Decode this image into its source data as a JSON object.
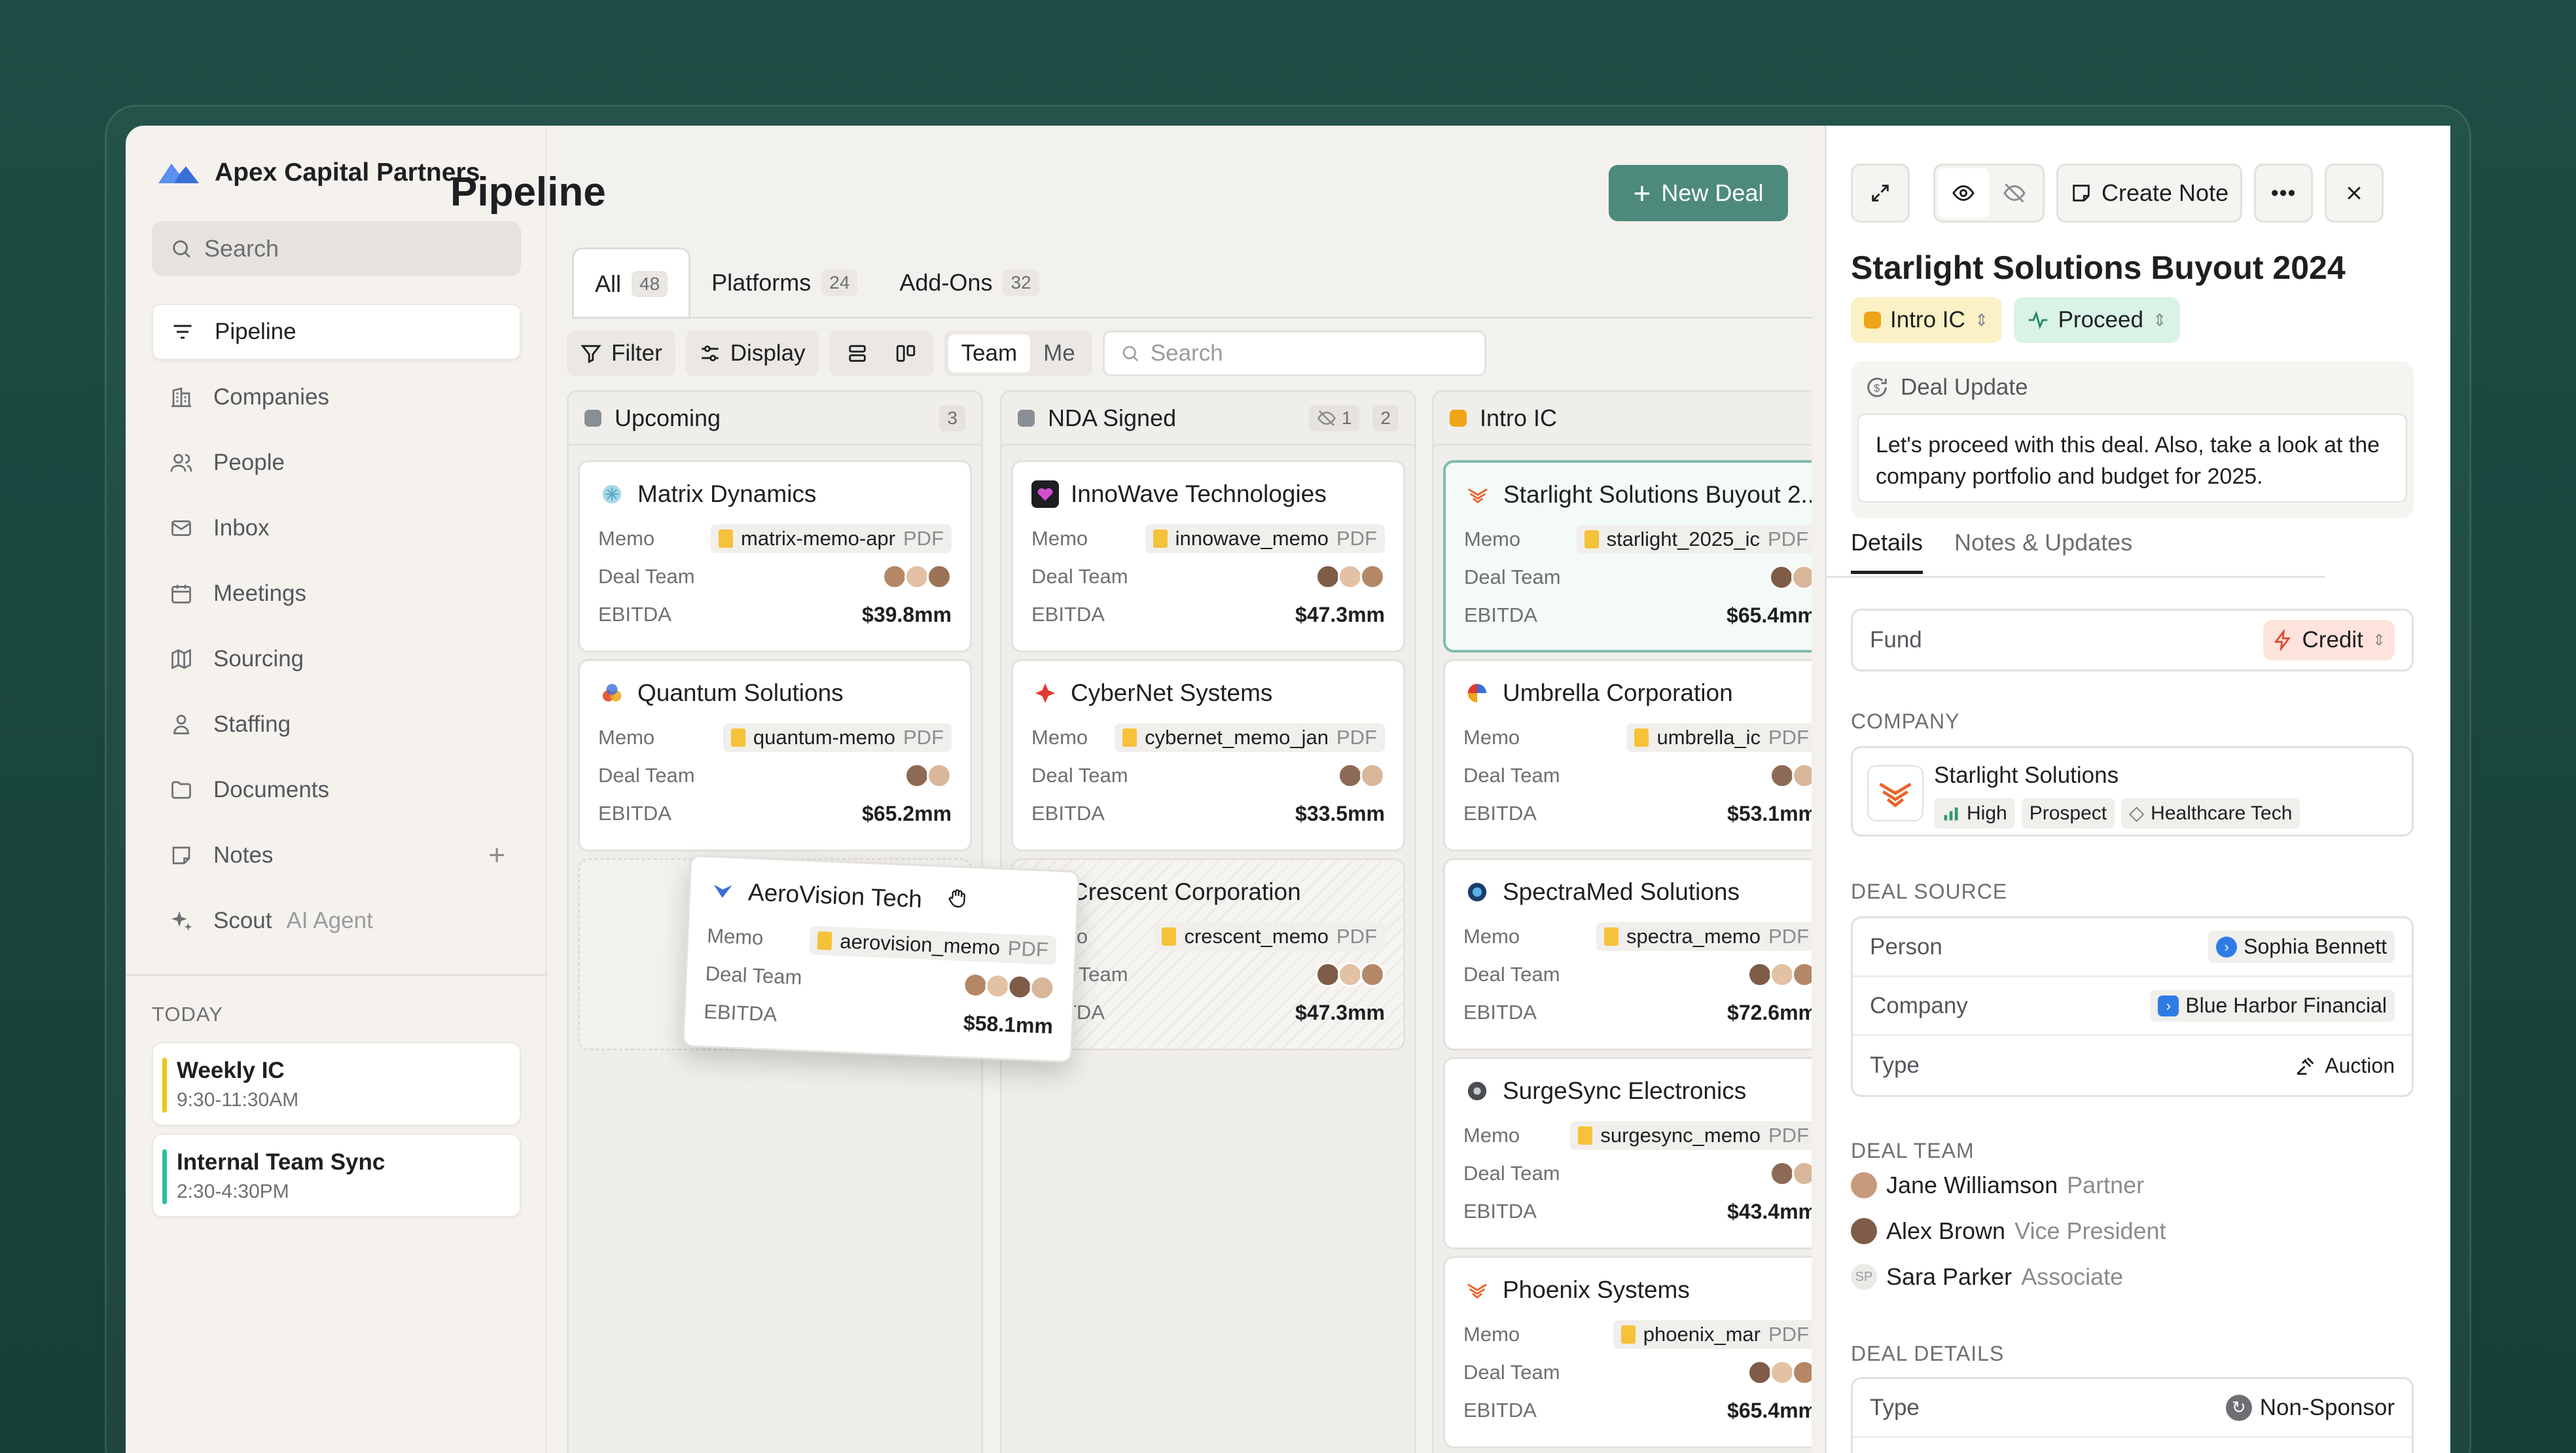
{
  "sidebar": {
    "brand": "Apex Capital Partners",
    "search_placeholder": "Search",
    "nav": [
      {
        "label": "Pipeline",
        "icon": "filter-lines-icon"
      },
      {
        "label": "Companies",
        "icon": "building-icon"
      },
      {
        "label": "People",
        "icon": "people-icon"
      },
      {
        "label": "Inbox",
        "icon": "mail-icon"
      },
      {
        "label": "Meetings",
        "icon": "calendar-icon"
      },
      {
        "label": "Sourcing",
        "icon": "map-icon"
      },
      {
        "label": "Staffing",
        "icon": "person-icon"
      },
      {
        "label": "Documents",
        "icon": "folder-icon"
      },
      {
        "label": "Notes",
        "icon": "note-icon"
      },
      {
        "label": "Scout",
        "extra": "AI Agent",
        "icon": "sparkle-icon"
      }
    ],
    "today_label": "TODAY",
    "events": [
      {
        "title": "Weekly IC",
        "time": "9:30-11:30AM",
        "color": "#f0c419"
      },
      {
        "title": "Internal Team Sync",
        "time": "2:30-4:30PM",
        "color": "#2cc0a4"
      }
    ]
  },
  "main": {
    "title": "Pipeline",
    "new_deal": "New Deal",
    "tabs": [
      {
        "label": "All",
        "count": "48"
      },
      {
        "label": "Platforms",
        "count": "24"
      },
      {
        "label": "Add-Ons",
        "count": "32"
      }
    ],
    "toolbar": {
      "filter": "Filter",
      "display": "Display",
      "team": "Team",
      "me": "Me",
      "search_placeholder": "Search"
    },
    "labels": {
      "memo": "Memo",
      "deal_team": "Deal Team",
      "ebitda": "EBITDA",
      "pdf": "PDF"
    },
    "columns": [
      {
        "name": "Upcoming",
        "count": "3",
        "color": "#8a8f96",
        "cards": [
          {
            "name": "Matrix Dynamics",
            "memo": "matrix-memo-apr",
            "ebitda": "$39.8mm"
          },
          {
            "name": "Quantum Solutions",
            "memo": "quantum-memo",
            "ebitda": "$65.2mm"
          }
        ]
      },
      {
        "name": "NDA Signed",
        "hidden": "1",
        "count": "2",
        "color": "#8a8f96",
        "cards": [
          {
            "name": "InnoWave Technologies",
            "memo": "innowave_memo",
            "ebitda": "$47.3mm"
          },
          {
            "name": "CyberNet Systems",
            "memo": "cybernet_memo_jan",
            "ebitda": "$33.5mm"
          },
          {
            "name": "Crescent Corporation",
            "memo": "crescent_memo",
            "ebitda": "$47.3mm"
          }
        ]
      },
      {
        "name": "Intro IC",
        "color": "#f0a418",
        "cards": [
          {
            "name": "Starlight Solutions Buyout 2...",
            "memo": "starlight_2025_ic",
            "ebitda": "$65.4mm"
          },
          {
            "name": "Umbrella Corporation",
            "memo": "umbrella_ic",
            "ebitda": "$53.1mm"
          },
          {
            "name": "SpectraMed Solutions",
            "memo": "spectra_memo",
            "ebitda": "$72.6mm"
          },
          {
            "name": "SurgeSync Electronics",
            "memo": "surgesync_memo",
            "ebitda": "$43.4mm"
          },
          {
            "name": "Phoenix Systems",
            "memo": "phoenix_mar",
            "ebitda": "$65.4mm"
          }
        ]
      }
    ],
    "drag_card": {
      "name": "AeroVision Tech",
      "memo": "aerovision_memo",
      "ebitda": "$58.1mm"
    }
  },
  "panel": {
    "create_note": "Create Note",
    "title": "Starlight Solutions Buyout 2024",
    "stage": "Intro IC",
    "status": "Proceed",
    "update_label": "Deal Update",
    "update_text": "Let's proceed with this deal. Also, take a look at the company portfolio and budget for 2025.",
    "tabs": [
      "Details",
      "Notes & Updates"
    ],
    "fund_label": "Fund",
    "fund_value": "Credit",
    "company_section": "COMPANY",
    "company": {
      "name": "Starlight Solutions",
      "priority": "High",
      "stage": "Prospect",
      "sector": "Healthcare Tech"
    },
    "source_section": "DEAL SOURCE",
    "source": [
      {
        "label": "Person",
        "value": "Sophia Bennett"
      },
      {
        "label": "Company",
        "value": "Blue Harbor Financial"
      },
      {
        "label": "Type",
        "value": "Auction"
      }
    ],
    "team_section": "DEAL TEAM",
    "team": [
      {
        "name": "Jane Williamson",
        "role": "Partner"
      },
      {
        "name": "Alex Brown",
        "role": "Vice President"
      },
      {
        "name": "Sara Parker",
        "role": "Associate",
        "initials": "SP"
      }
    ],
    "details_section": "DEAL DETAILS",
    "details": [
      {
        "label": "Type",
        "value": "Non-Sponsor"
      }
    ]
  }
}
